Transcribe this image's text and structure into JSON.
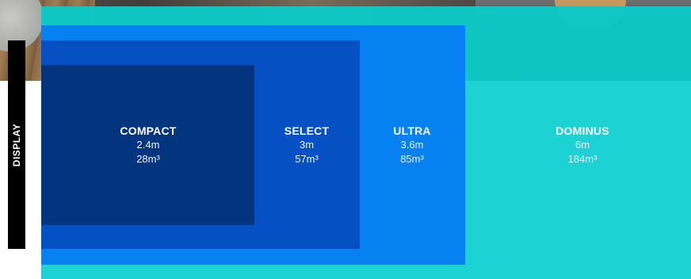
{
  "display_tab": {
    "label": "DISPLAY"
  },
  "zones": {
    "compact": {
      "name": "COMPACT",
      "length": "2.4m",
      "volume": "28m³"
    },
    "select": {
      "name": "SELECT",
      "length": "3m",
      "volume": "57m³"
    },
    "ultra": {
      "name": "ULTRA",
      "length": "3.6m",
      "volume": "85m³"
    },
    "dominus": {
      "name": "DOMINUS",
      "length": "6m",
      "volume": "184m³"
    }
  },
  "colors": {
    "compact": "#03357f",
    "select": "#0550c2",
    "ultra": "#0581f2",
    "dominus": "#14d0d0"
  }
}
